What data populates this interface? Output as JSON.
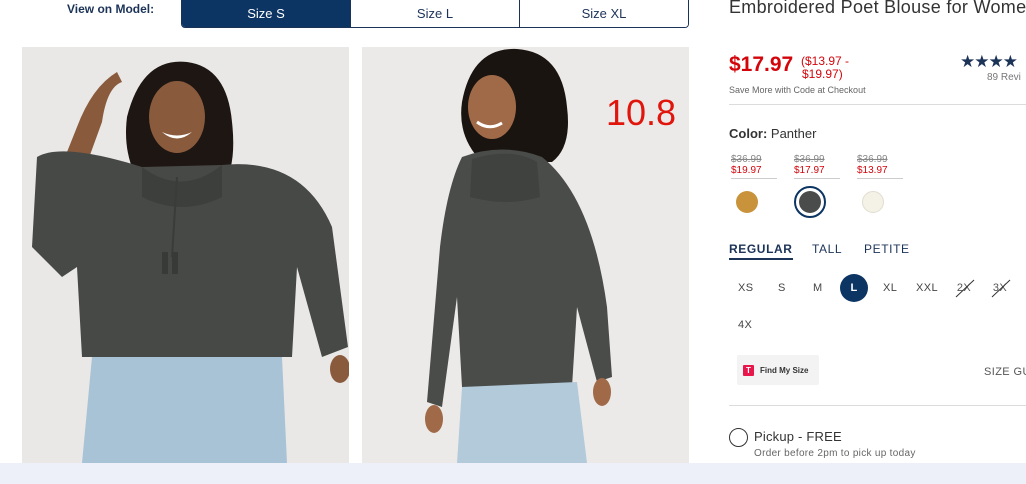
{
  "view_on_model": {
    "label": "View on Model:",
    "tabs": [
      "Size S",
      "Size L",
      "Size XL"
    ],
    "selected": "Size S"
  },
  "overlay_number": "10.8",
  "product": {
    "title": "Embroidered Poet Blouse for Women",
    "price": "$17.97",
    "price_range_line1": "($13.97 -",
    "price_range_line2": "$19.97)",
    "stars": "★★★★",
    "reviews": "89 Revi",
    "save_more": "Save More with Code at Checkout"
  },
  "color": {
    "label": "Color:",
    "value": "Panther",
    "swatches": [
      {
        "was": "$36.99",
        "now": "$19.97",
        "hex": "#c8933a",
        "name": "mustard"
      },
      {
        "was": "$36.99",
        "now": "$17.97",
        "hex": "#4a4c4c",
        "name": "panther"
      },
      {
        "was": "$36.99",
        "now": "$13.97",
        "hex": "#f4f1e6",
        "name": "cream"
      }
    ]
  },
  "fit_tabs": [
    "REGULAR",
    "TALL",
    "PETITE"
  ],
  "sizes": [
    "XS",
    "S",
    "M",
    "L",
    "XL",
    "XXL",
    "2X",
    "3X",
    "4X"
  ],
  "selected_size": "L",
  "find_my_size": {
    "logo": "T",
    "label": "Find My Size"
  },
  "size_guide": "SIZE GU",
  "pickup": {
    "label": "Pickup - FREE",
    "note": "Order before 2pm to pick up today"
  },
  "colors": {
    "navy": "#0c3563",
    "sale_red": "#d3050b",
    "overlay_red": "#e0150b"
  }
}
